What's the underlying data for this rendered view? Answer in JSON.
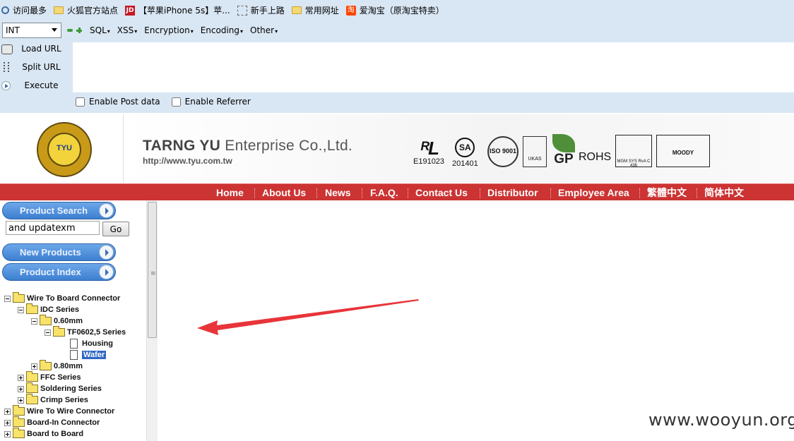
{
  "bookmarks": [
    {
      "label": "访问最多",
      "icon": "search-icon"
    },
    {
      "label": "火狐官方站点",
      "icon": "folder-icon"
    },
    {
      "label": "【苹果iPhone 5s】苹...",
      "icon": "jd-icon",
      "icon_text": "JD"
    },
    {
      "label": "新手上路",
      "icon": "dashed-page-icon"
    },
    {
      "label": "常用网址",
      "icon": "folder-icon"
    },
    {
      "label": "爱淘宝（原淘宝特卖）",
      "icon": "taobao-icon",
      "icon_text": "淘"
    }
  ],
  "hackbar": {
    "type_select": "INT",
    "menus": [
      "SQL",
      "XSS",
      "Encryption",
      "Encoding",
      "Other"
    ],
    "actions": {
      "load": "Load URL",
      "split": "Split URL",
      "execute": "Execute"
    },
    "url_value": "",
    "checks": {
      "post": "Enable Post data",
      "referrer": "Enable Referrer"
    }
  },
  "site": {
    "logo_text": "TYU",
    "company_bold": "TARNG YU",
    "company_rest": "Enterprise Co.,Ltd.",
    "url": "http://www.tyu.com.tw",
    "certs": {
      "ul_mark": "ᴿL",
      "ul_number": "E191023",
      "sa_mark": "SA",
      "sa_number": "201401",
      "iso": "ISO 9001",
      "ukas": "UKAS",
      "gp": "GP",
      "rohs": "ROHS",
      "mgm": "MGM SYS RvA C 436",
      "moody": "MOODY"
    },
    "nav": [
      "Home",
      "About Us",
      "News",
      "F.A.Q.",
      "Contact Us",
      "Distributor",
      "Employee Area",
      "繁體中文",
      "简体中文"
    ]
  },
  "sidebar": {
    "search_title": "Product Search",
    "search_value": "and updatexm",
    "go_label": "Go",
    "new_products": "New Products",
    "product_index": "Product Index",
    "tree": {
      "wire_to_board": "Wire To Board Connector",
      "idc": "IDC Series",
      "mm060": "0.60mm",
      "tf0602": "TF0602,5 Series",
      "housing": "Housing",
      "wafer": "Wafer",
      "mm080": "0.80mm",
      "ffc": "FFC Series",
      "soldering": "Soldering Series",
      "crimp": "Crimp Series",
      "wire_to_wire": "Wire To Wire Connector",
      "board_in": "Board-In Connector",
      "board_to_board": "Board to Board"
    }
  },
  "watermark": "www.wooyun.org",
  "colors": {
    "nav_red": "#cc3333",
    "pill_blue": "#3d7fd0",
    "arrow_red": "#e8343a",
    "toolbar_bg": "#d9e6f3"
  }
}
